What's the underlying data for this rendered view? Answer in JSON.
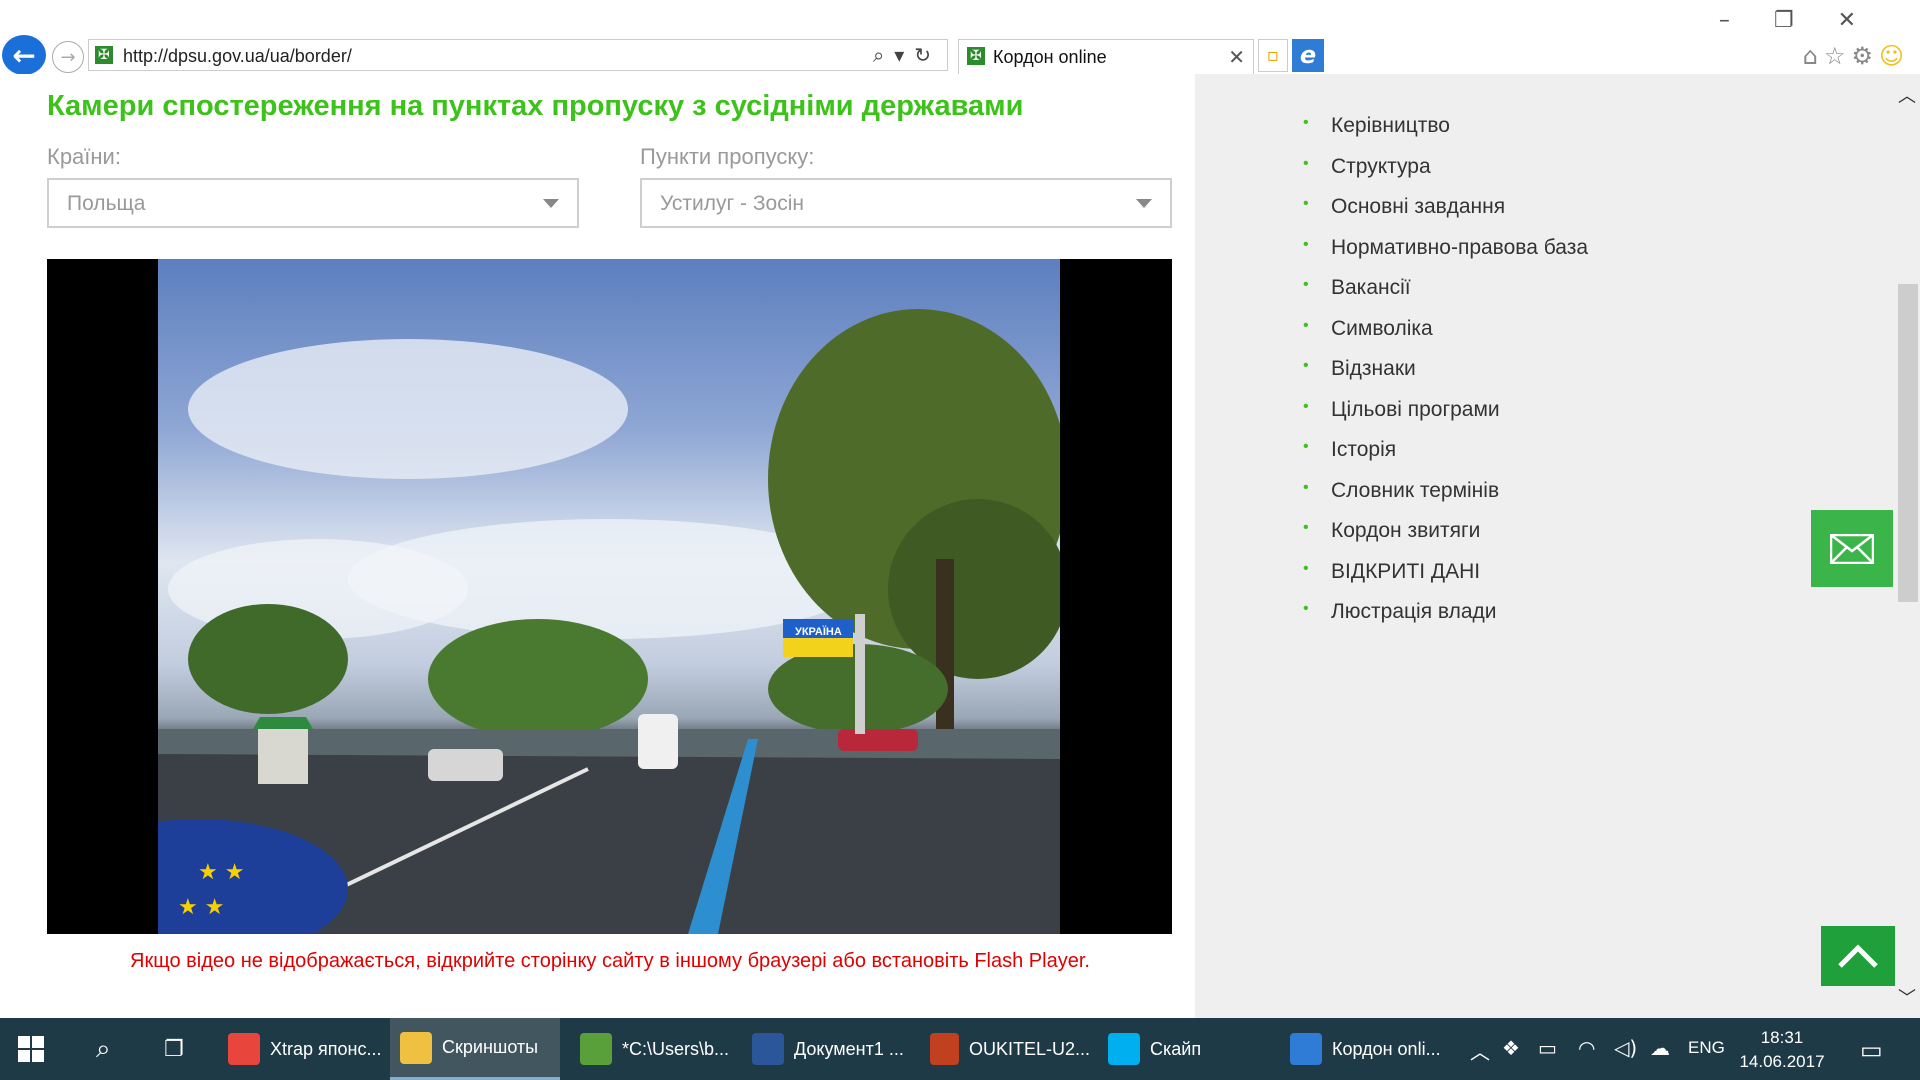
{
  "browser": {
    "url": "http://dpsu.gov.ua/ua/border/",
    "tab_title": "Кордон online"
  },
  "page": {
    "heading": "Камери спостереження на пунктах пропуску з сусідніми державами",
    "country_label": "Країни:",
    "country_value": "Польща",
    "checkpoint_label": "Пункти пропуску:",
    "checkpoint_value": "Устилуг - Зосін",
    "video_note": "Якщо відео не відображається, відкрийте сторінку сайту в іншому браузері або встановіть Flash Player.",
    "sign_text": "УКРАЇНА"
  },
  "sidebar": {
    "items": [
      "Керівництво",
      "Структура",
      "Основні завдання",
      "Нормативно-правова база",
      "Вакансії",
      "Символіка",
      "Відзнаки",
      "Цільові програми",
      "Історія",
      "Словник термінів",
      "Кордон звитяги",
      "ВІДКРИТІ ДАНІ",
      "Люстрація влади"
    ]
  },
  "taskbar": {
    "items": [
      {
        "label": "Xtrap японс...",
        "icon": "chrome-icon",
        "color": "#e8453c"
      },
      {
        "label": "Скриншоты",
        "icon": "folder-icon",
        "color": "#f0c040"
      },
      {
        "label": "*C:\\Users\\b...",
        "icon": "notepad-icon",
        "color": "#5aa03a"
      },
      {
        "label": "Документ1 ...",
        "icon": "word-icon",
        "color": "#2b579a"
      },
      {
        "label": "OUKITEL-U2...",
        "icon": "app-eye-icon",
        "color": "#c04020"
      },
      {
        "label": "Скайп",
        "icon": "skype-icon",
        "color": "#00aff0"
      },
      {
        "label": "Кордон onli...",
        "icon": "ie-icon",
        "color": "#2e7cd6"
      }
    ],
    "lang": "ENG",
    "time": "18:31",
    "date": "14.06.2017"
  },
  "colors": {
    "accent_green": "#3cc21a",
    "button_green": "#3bb54a",
    "note_red": "#e00000",
    "taskbar": "#1f3a47"
  }
}
